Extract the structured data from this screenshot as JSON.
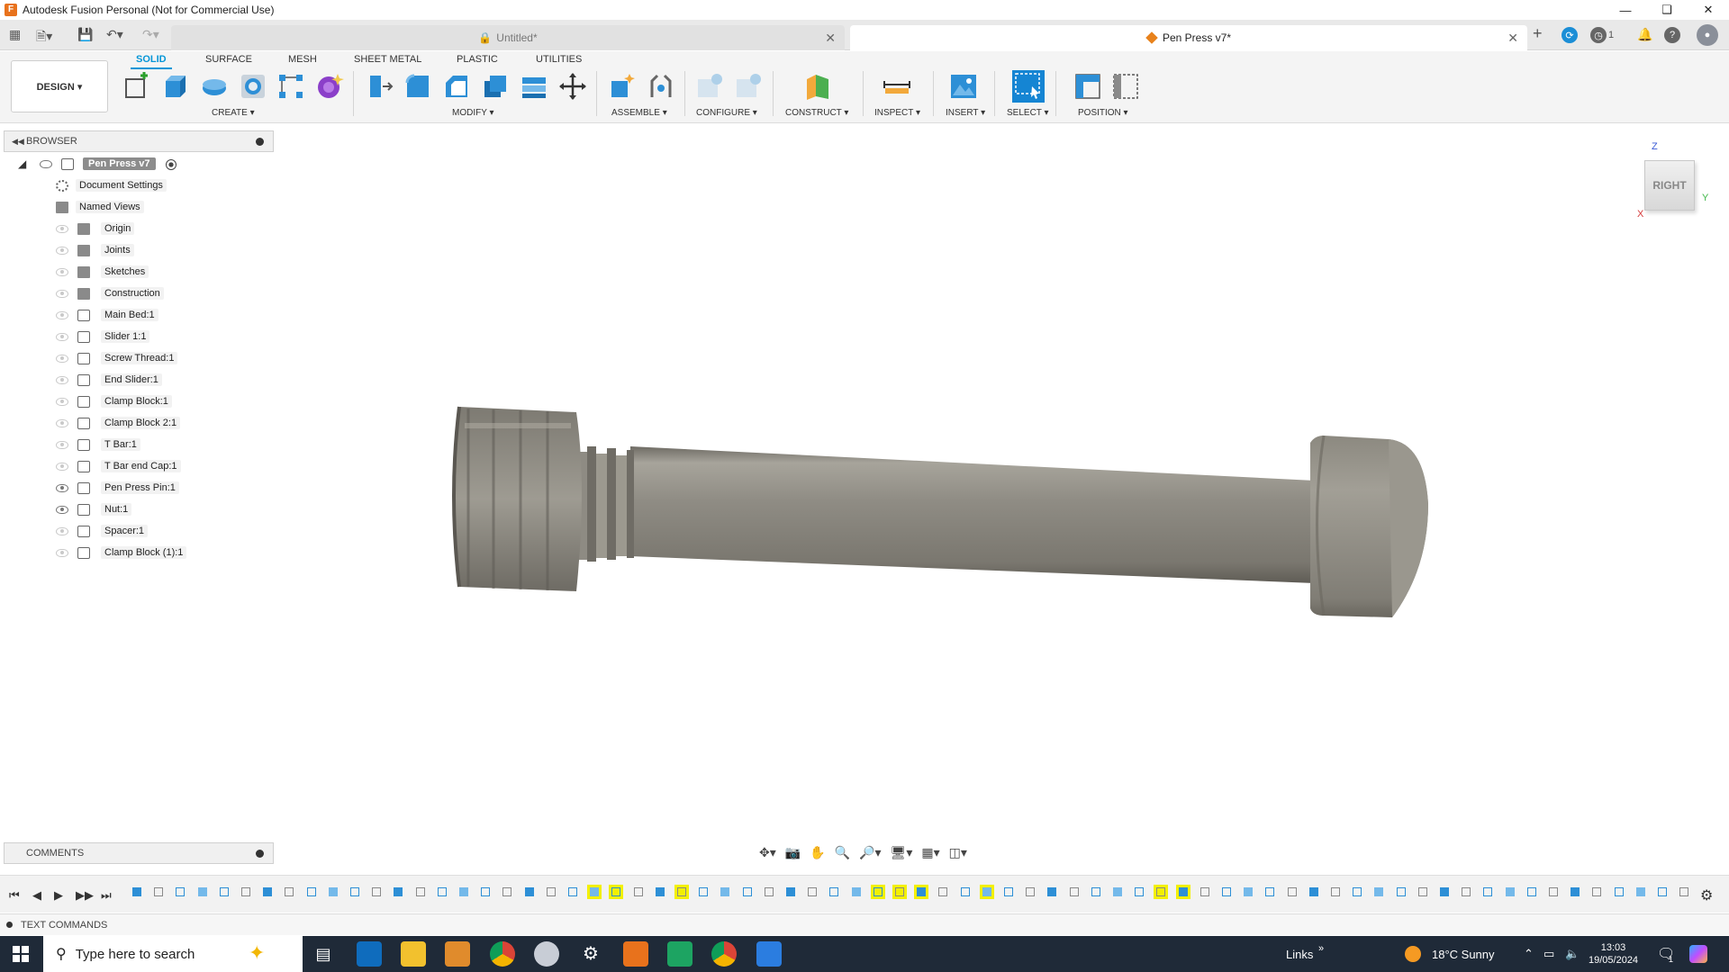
{
  "window": {
    "title": "Autodesk Fusion Personal (Not for Commercial Use)"
  },
  "tabs": {
    "untitled": "Untitled*",
    "pen_press": "Pen Press v7*",
    "job_count": "1"
  },
  "ribbon": {
    "tabs": [
      "SOLID",
      "SURFACE",
      "MESH",
      "SHEET METAL",
      "PLASTIC",
      "UTILITIES"
    ],
    "design_label": "DESIGN ▾",
    "groups": {
      "create": "CREATE ▾",
      "modify": "MODIFY ▾",
      "assemble": "ASSEMBLE ▾",
      "configure": "CONFIGURE ▾",
      "construct": "CONSTRUCT ▾",
      "inspect": "INSPECT ▾",
      "insert": "INSERT ▾",
      "select": "SELECT ▾",
      "position": "POSITION ▾"
    }
  },
  "browser": {
    "title": "BROWSER",
    "root": "Pen Press v7",
    "items": [
      {
        "label": "Document Settings",
        "visible": null,
        "icon": "gear-icon"
      },
      {
        "label": "Named Views",
        "visible": null,
        "icon": "folder-icon"
      },
      {
        "label": "Origin",
        "visible": false,
        "icon": "folder-icon"
      },
      {
        "label": "Joints",
        "visible": false,
        "icon": "folder-icon"
      },
      {
        "label": "Sketches",
        "visible": false,
        "icon": "folder-icon"
      },
      {
        "label": "Construction",
        "visible": false,
        "icon": "folder-icon"
      },
      {
        "label": "Main Bed:1",
        "visible": false,
        "icon": "component-icon"
      },
      {
        "label": "Slider 1:1",
        "visible": false,
        "icon": "component-icon"
      },
      {
        "label": "Screw Thread:1",
        "visible": false,
        "icon": "component-icon"
      },
      {
        "label": "End Slider:1",
        "visible": false,
        "icon": "component-icon"
      },
      {
        "label": "Clamp Block:1",
        "visible": false,
        "icon": "component-icon"
      },
      {
        "label": "Clamp Block 2:1",
        "visible": false,
        "icon": "component-icon"
      },
      {
        "label": "T Bar:1",
        "visible": false,
        "icon": "component-icon"
      },
      {
        "label": "T Bar end Cap:1",
        "visible": false,
        "icon": "component-icon"
      },
      {
        "label": "Pen Press Pin:1",
        "visible": true,
        "icon": "component-icon"
      },
      {
        "label": "Nut:1",
        "visible": true,
        "icon": "component-icon"
      },
      {
        "label": "Spacer:1",
        "visible": false,
        "icon": "component-icon"
      },
      {
        "label": "Clamp Block (1):1",
        "visible": false,
        "icon": "component-icon"
      }
    ]
  },
  "viewcube": {
    "face": "RIGHT",
    "axis_z": "Z",
    "axis_y": "Y",
    "axis_x": "X"
  },
  "comments": {
    "title": "COMMENTS"
  },
  "text_commands": {
    "title": "TEXT COMMANDS"
  },
  "taskbar": {
    "search_placeholder": "Type here to search",
    "links": "Links",
    "weather": "18°C  Sunny",
    "time": "13:03",
    "date": "19/05/2024",
    "notifications": "1"
  },
  "colors": {
    "accent": "#0696d7",
    "model": "#8d8a82",
    "taskbar": "#1f2a38",
    "fusion_orange": "#e8721c"
  }
}
